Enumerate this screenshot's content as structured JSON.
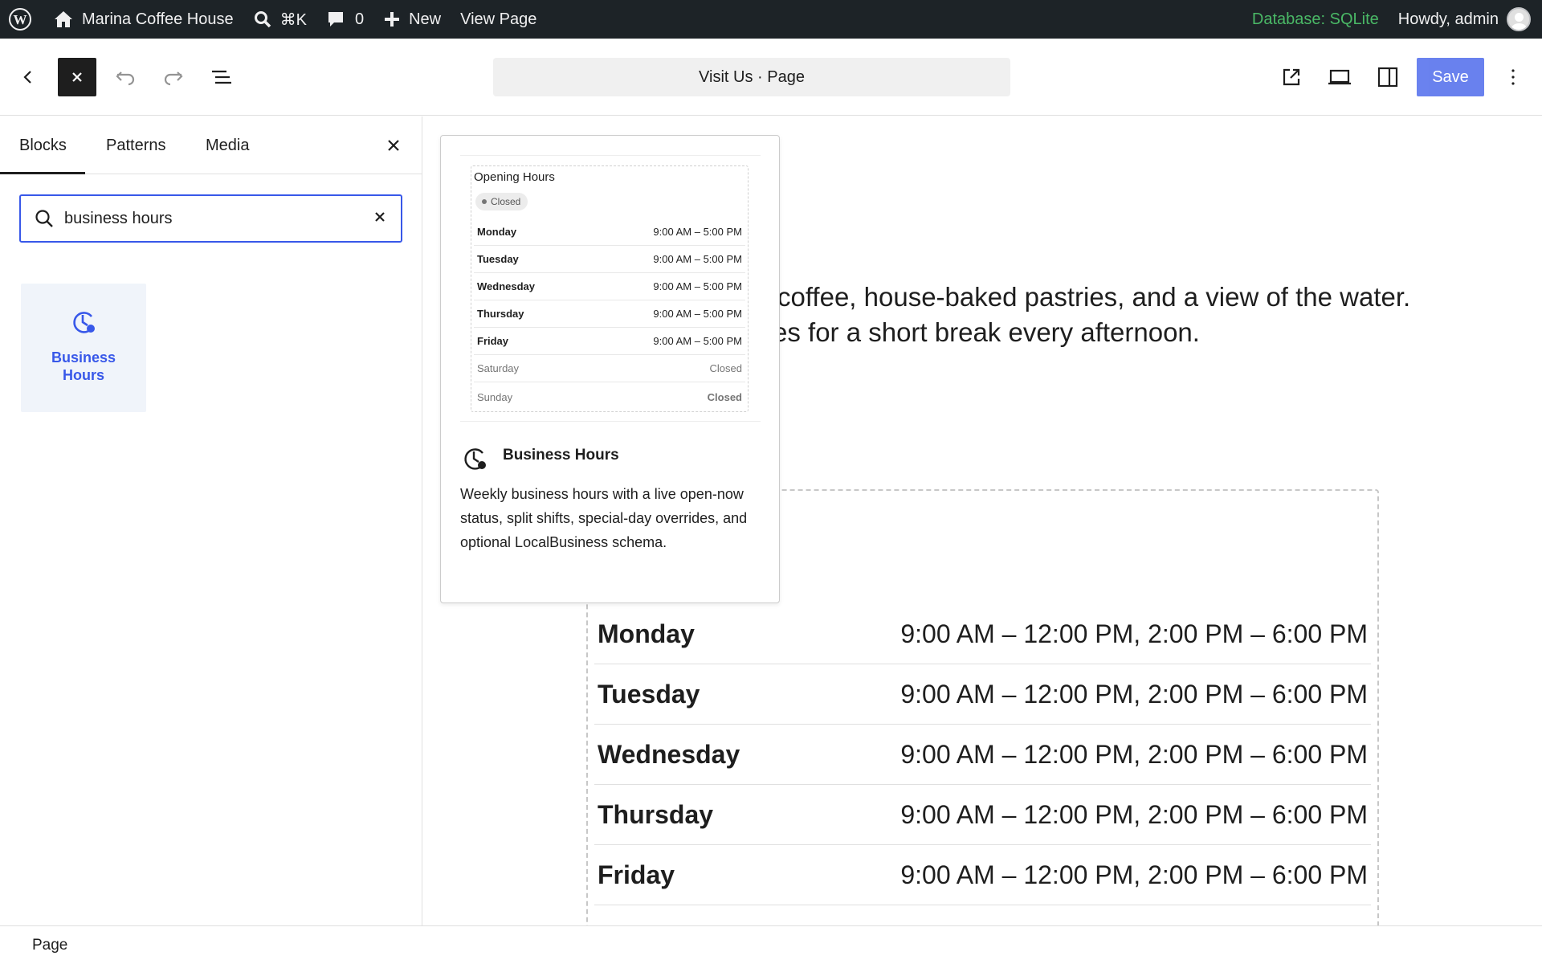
{
  "admin_bar": {
    "site_name": "Marina Coffee House",
    "search_shortcut": "⌘K",
    "comments_count": "0",
    "new_label": "New",
    "view_page_label": "View Page",
    "database_label": "Database: SQLite",
    "howdy_label": "Howdy, admin",
    "db_color": "#4ab866"
  },
  "header": {
    "document_title": "Visit Us · Page",
    "save_label": "Save",
    "accent": "#3858e9"
  },
  "inserter": {
    "tabs": [
      {
        "label": "Blocks",
        "active": true
      },
      {
        "label": "Patterns",
        "active": false
      },
      {
        "label": "Media",
        "active": false
      }
    ],
    "search_value": "business hours",
    "results": [
      {
        "label": "Business Hours",
        "icon": "clock-icon"
      }
    ]
  },
  "canvas": {
    "intro_line_1": "coffee, house-baked pastries, and a view of the water.",
    "intro_line_2": "es for a short break every afternoon.",
    "hours": [
      {
        "day": "Monday",
        "time": "9:00 AM – 12:00 PM, 2:00 PM – 6:00 PM"
      },
      {
        "day": "Tuesday",
        "time": "9:00 AM – 12:00 PM, 2:00 PM – 6:00 PM"
      },
      {
        "day": "Wednesday",
        "time": "9:00 AM – 12:00 PM, 2:00 PM – 6:00 PM"
      },
      {
        "day": "Thursday",
        "time": "9:00 AM – 12:00 PM, 2:00 PM – 6:00 PM"
      },
      {
        "day": "Friday",
        "time": "9:00 AM – 12:00 PM, 2:00 PM – 6:00 PM"
      }
    ]
  },
  "preview": {
    "mini_title": "Opening Hours",
    "mini_status": "Closed",
    "mini_rows": [
      {
        "day": "Monday",
        "time": "9:00 AM – 5:00 PM"
      },
      {
        "day": "Tuesday",
        "time": "9:00 AM – 5:00 PM"
      },
      {
        "day": "Wednesday",
        "time": "9:00 AM – 5:00 PM"
      },
      {
        "day": "Thursday",
        "time": "9:00 AM – 5:00 PM"
      },
      {
        "day": "Friday",
        "time": "9:00 AM – 5:00 PM"
      },
      {
        "day": "Saturday",
        "time": "Closed"
      },
      {
        "day": "Sunday",
        "time": "Closed"
      }
    ],
    "block_title": "Business Hours",
    "block_description": "Weekly business hours with a live open-now status, split shifts, special-day overrides, and optional LocalBusiness schema."
  },
  "footer": {
    "breadcrumb": "Page"
  }
}
